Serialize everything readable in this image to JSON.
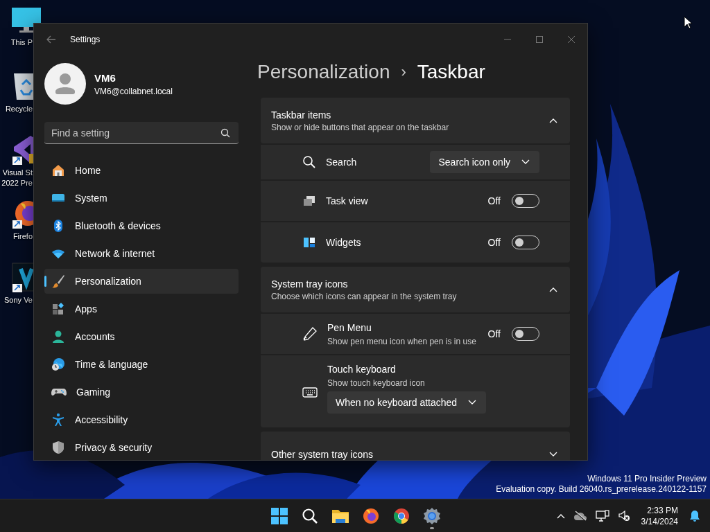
{
  "desktop_icons": [
    {
      "lines": [
        "This P"
      ]
    },
    {
      "lines": [
        "Recycle"
      ]
    },
    {
      "lines": [
        "Visual St",
        "2022 Pre"
      ]
    },
    {
      "lines": [
        "Firefo"
      ]
    },
    {
      "lines": [
        "Sony Ve"
      ]
    }
  ],
  "window": {
    "title": "Settings"
  },
  "account": {
    "name": "VM6",
    "email": "VM6@collabnet.local"
  },
  "search": {
    "placeholder": "Find a setting"
  },
  "nav": [
    {
      "label": "Home",
      "selected": false
    },
    {
      "label": "System",
      "selected": false
    },
    {
      "label": "Bluetooth & devices",
      "selected": false
    },
    {
      "label": "Network & internet",
      "selected": false
    },
    {
      "label": "Personalization",
      "selected": true
    },
    {
      "label": "Apps",
      "selected": false
    },
    {
      "label": "Accounts",
      "selected": false
    },
    {
      "label": "Time & language",
      "selected": false
    },
    {
      "label": "Gaming",
      "selected": false
    },
    {
      "label": "Accessibility",
      "selected": false
    },
    {
      "label": "Privacy & security",
      "selected": false
    }
  ],
  "breadcrumb": {
    "parent": "Personalization",
    "separator": "›",
    "current": "Taskbar"
  },
  "sections": [
    {
      "title": "Taskbar items",
      "subtitle": "Show or hide buttons that appear on the taskbar",
      "expanded": true,
      "items": [
        {
          "kind": "dropdown",
          "label": "Search",
          "value": "Search icon only"
        },
        {
          "kind": "toggle",
          "label": "Task view",
          "state_text": "Off",
          "on": false
        },
        {
          "kind": "toggle",
          "label": "Widgets",
          "state_text": "Off",
          "on": false
        }
      ]
    },
    {
      "title": "System tray icons",
      "subtitle": "Choose which icons can appear in the system tray",
      "expanded": true,
      "items": [
        {
          "kind": "toggle",
          "label": "Pen Menu",
          "description": "Show pen menu icon when pen is in use",
          "state_text": "Off",
          "on": false
        },
        {
          "kind": "dropdown_below",
          "label": "Touch keyboard",
          "description": "Show touch keyboard icon",
          "value": "When no keyboard attached"
        }
      ]
    },
    {
      "title": "Other system tray icons",
      "expanded": false
    }
  ],
  "desktop_notice": [
    "Windows 11 Pro Insider Preview",
    "Evaluation copy. Build 26040.rs_prerelease.240122-1157"
  ],
  "taskbar": {
    "buttons": [
      {
        "running": false
      },
      {
        "running": false
      },
      {
        "running": false
      },
      {
        "running": false
      },
      {
        "running": false
      },
      {
        "running": true
      }
    ],
    "time": "2:33 PM",
    "date": "3/14/2024"
  }
}
